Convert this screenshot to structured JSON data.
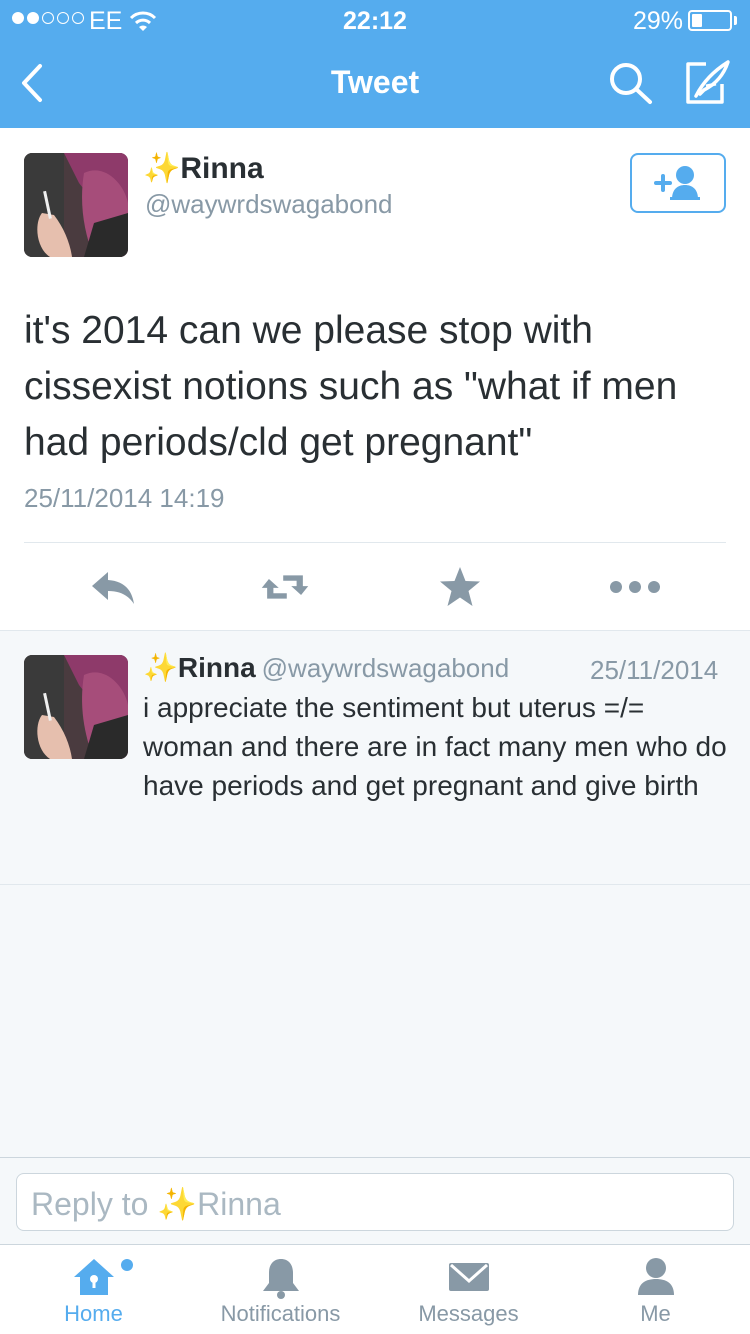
{
  "status_bar": {
    "carrier": "EE",
    "time": "22:12",
    "battery_percent": "29%",
    "battery_level": 0.29,
    "signal_bars": 2
  },
  "nav": {
    "title": "Tweet",
    "back_icon": "chevron-left-icon",
    "search_icon": "search-icon",
    "compose_icon": "compose-icon"
  },
  "tweet": {
    "emoji": "✨",
    "name": "Rinna",
    "handle": "@waywrdswagabond",
    "text": "it's 2014 can we please stop with cissexist notions such as \"what if men had periods/cld get pregnant\"",
    "timestamp": "25/11/2014 14:19",
    "follow_icon": "add-user-icon",
    "actions": [
      "reply-icon",
      "retweet-icon",
      "favorite-icon",
      "more-icon"
    ]
  },
  "reply": {
    "emoji": "✨",
    "name": "Rinna",
    "handle": "@waywrdswagabond",
    "date": "25/11/2014",
    "text": "i appreciate the sentiment but uterus =/= woman and there are in fact many men who do have periods and get pregnant and give birth"
  },
  "reply_box": {
    "placeholder_prefix": "Reply to ",
    "emoji": "✨",
    "name": "Rinna"
  },
  "tabs": [
    {
      "label": "Home",
      "icon": "home-icon",
      "active": true
    },
    {
      "label": "Notifications",
      "icon": "bell-icon",
      "active": false
    },
    {
      "label": "Messages",
      "icon": "envelope-icon",
      "active": false
    },
    {
      "label": "Me",
      "icon": "person-icon",
      "active": false
    }
  ],
  "colors": {
    "brand": "#55acee",
    "text": "#292f33",
    "muted": "#8899a6",
    "sparkle": "#f2c200"
  }
}
